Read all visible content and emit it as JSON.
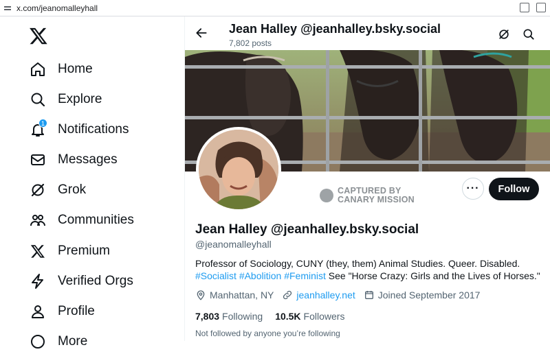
{
  "browser": {
    "url": "x.com/jeanomalleyhall"
  },
  "nav": {
    "items": [
      {
        "label": "Home",
        "icon": "home-icon"
      },
      {
        "label": "Explore",
        "icon": "search-icon"
      },
      {
        "label": "Notifications",
        "icon": "bell-icon",
        "badge": "1"
      },
      {
        "label": "Messages",
        "icon": "mail-icon"
      },
      {
        "label": "Grok",
        "icon": "grok-icon"
      },
      {
        "label": "Communities",
        "icon": "people-icon"
      },
      {
        "label": "Premium",
        "icon": "x-logo-icon"
      },
      {
        "label": "Verified Orgs",
        "icon": "lightning-icon"
      },
      {
        "label": "Profile",
        "icon": "person-icon"
      },
      {
        "label": "More",
        "icon": "more-circle-icon"
      }
    ]
  },
  "header": {
    "title": "Jean Halley @jeanhalley.bsky.social",
    "posts": "7,802 posts"
  },
  "stamp": {
    "line1": "CAPTURED BY",
    "line2": "CANARY MISSION"
  },
  "profile": {
    "more": "···",
    "follow": "Follow",
    "name": "Jean Halley @jeanhalley.bsky.social",
    "handle": "@jeanomalleyhall",
    "bio_line1": "Professor of Sociology, CUNY (they, them) Animal Studies. Queer. Disabled.",
    "bio_tags": [
      "#Socialist",
      "#Abolition",
      "#Feminist"
    ],
    "bio_line2_rest": " See \"Horse Crazy: Girls and the Lives of Horses.\"",
    "location": "Manhattan, NY",
    "website": "jeanhalley.net",
    "joined": "Joined September 2017",
    "following_count": "7,803",
    "following_label": "Following",
    "followers_count": "10.5K",
    "followers_label": "Followers",
    "not_followed": "Not followed by anyone you’re following"
  },
  "colors": {
    "accent": "#1d9bf0",
    "text": "#0f1419",
    "muted": "#536471"
  }
}
